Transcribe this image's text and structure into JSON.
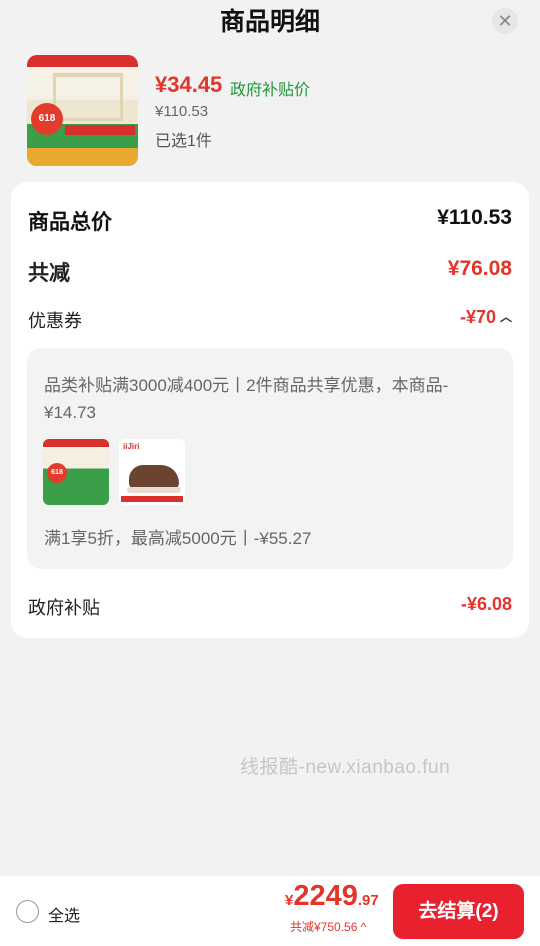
{
  "header": {
    "title": "商品明细",
    "close_glyph": "✕"
  },
  "product": {
    "thumb_badge": "618",
    "price": "¥34.45",
    "subsidy_label": "政府补贴价",
    "original_price": "¥110.53",
    "selected_count": "已选1件"
  },
  "summary": {
    "total_label": "商品总价",
    "total_value": "¥110.53",
    "reduce_label": "共减",
    "reduce_value": "¥76.08",
    "coupon_label": "优惠券",
    "coupon_value": "-¥70",
    "coupon_box": {
      "line1": "品类补贴满3000减400元丨2件商品共享优惠，本商品-¥14.73",
      "mini2_brand": "iiJiri",
      "line2": "满1享5折，最高减5000元丨-¥55.27"
    },
    "subsidy_label": "政府补贴",
    "subsidy_value": "-¥6.08"
  },
  "watermark": "线报酷-new.xianbao.fun",
  "bottom": {
    "select_all": "全选",
    "currency": "¥",
    "total_int": "2249",
    "total_dec": ".97",
    "discount": "共减¥750.56 ^",
    "checkout": "去结算(2)"
  },
  "colors": {
    "accent_red": "#e3352b",
    "green": "#1e9a3a",
    "button_red": "#e9202d"
  },
  "icons": [
    "close-icon",
    "chevron-up-icon",
    "radio-icon"
  ]
}
